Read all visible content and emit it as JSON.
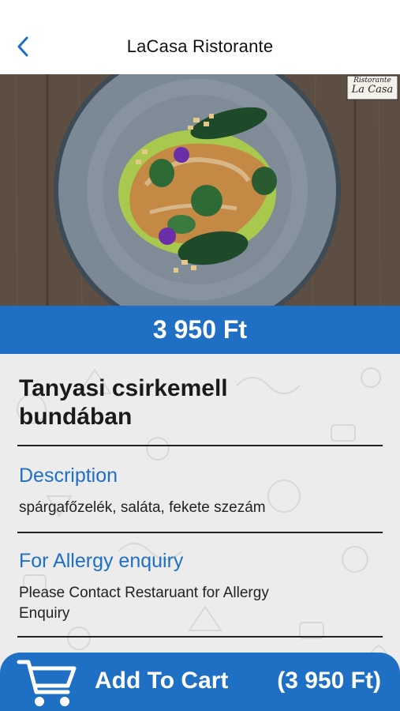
{
  "nav": {
    "title": "LaCasa Ristorante",
    "back_icon": "chevron-left-icon"
  },
  "hero": {
    "logo_text_top": "Ristorante",
    "logo_text_bottom": "La Casa"
  },
  "product": {
    "price": "3 950 Ft",
    "name_line1": "Tanyasi csirkemell",
    "name_line2": "bundában"
  },
  "description": {
    "title": "Description",
    "text": "spárgafőzelék, saláta, fekete szezám"
  },
  "allergy": {
    "title": "For Allergy enquiry",
    "text_line1": "Please Contact Restaruant for Allergy",
    "text_line2": "Enquiry"
  },
  "cart": {
    "label": "Add To Cart",
    "price": "(3 950 Ft)",
    "icon": "shopping-cart-icon"
  },
  "colors": {
    "accent": "#1f6fc5",
    "content_bg": "#ececec"
  }
}
